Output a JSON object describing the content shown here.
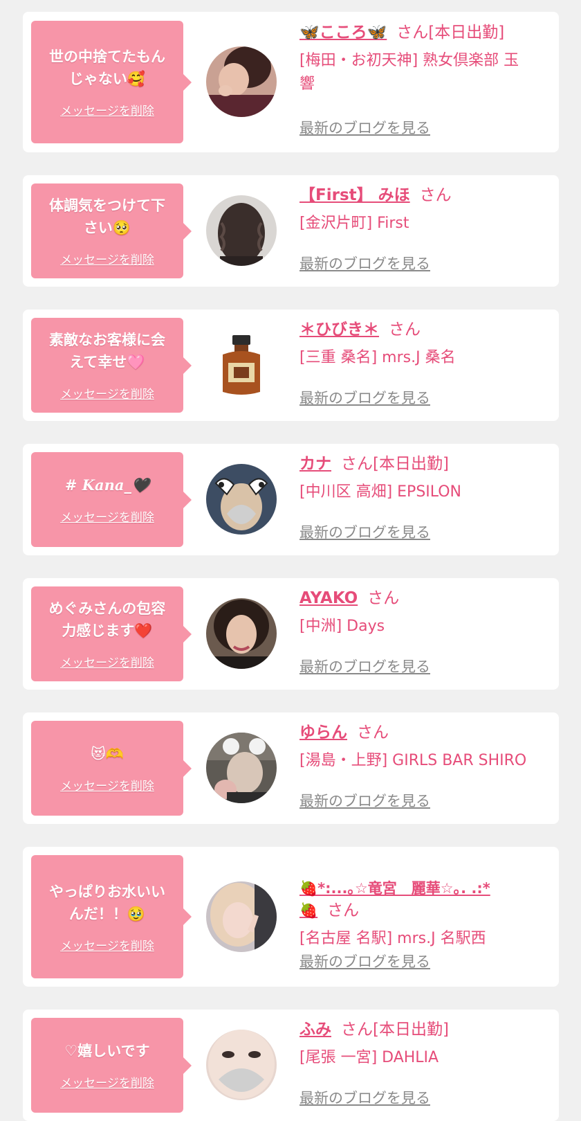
{
  "delete_label": "メッセージを削除",
  "blog_label": "最新のブログを見る",
  "colors": {
    "page_bg": "#f0f0f0",
    "bubble": "#f795a8",
    "accent": "#e64c79",
    "link_gray": "#8a8a8a"
  },
  "cards": [
    {
      "message": "世の中捨てたもん\nじゃない🥰",
      "name": "🦋こころ🦋",
      "suffix": "さん[本日出勤]",
      "shop": "[梅田・お初天神] 熟女倶楽部 玉\n響",
      "avatar_icon": "woman-portrait"
    },
    {
      "message": "体調気をつけて下\nさい🥺",
      "name": "【First】 みほ",
      "suffix": "さん",
      "shop": "[金沢片町] First",
      "avatar_icon": "curly-hair-photo"
    },
    {
      "message": "素敵なお客様に会\nえて幸せ🩷",
      "name": "＊ひびき＊",
      "suffix": "さん",
      "shop": "[三重 桑名] mrs.J 桑名",
      "avatar_icon": "whisky-bottle"
    },
    {
      "message": "# Kana_🖤",
      "name": "カナ",
      "suffix": "さん[本日出勤]",
      "shop": "[中川区 高畑] EPSILON",
      "avatar_icon": "cow-ears-photo"
    },
    {
      "message": "めぐみさんの包容\n力感じます❤️",
      "name": "AYAKO",
      "suffix": "さん",
      "shop": "[中洲] Days",
      "avatar_icon": "woman-portrait"
    },
    {
      "message": "😻🫶",
      "name": "ゆらん",
      "suffix": "さん",
      "shop": "[湯島・上野] GIRLS BAR SHIRO",
      "avatar_icon": "bear-ears-photo"
    },
    {
      "message": "やっぱりお水いい\nんだ！！🥹",
      "name": "🍓*:...｡☆竜宮　麗華☆｡. .:*\n🍓",
      "suffix": "さん",
      "shop": "[名古屋 名駅] mrs.J 名駅西",
      "avatar_icon": "blonde-portrait"
    },
    {
      "message": "♡嬉しいです",
      "name": "ふみ",
      "suffix": "さん[本日出勤]",
      "shop": "[尾張 一宮] DAHLIA",
      "avatar_icon": "face-closeup"
    }
  ]
}
